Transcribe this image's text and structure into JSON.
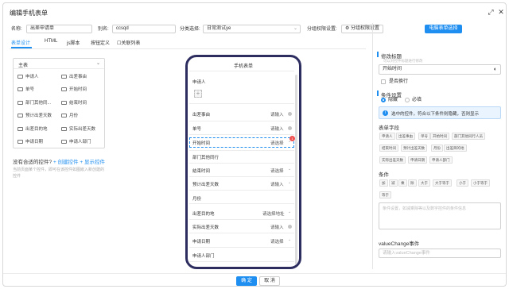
{
  "dialog": {
    "title": "编辑手机表单"
  },
  "header": {
    "name_label": "名称:",
    "name_value": "出差申请单",
    "alias_label": "别名:",
    "alias_value": "ccsqd",
    "category_label": "分类选择:",
    "category_value": "日常测试ye",
    "permission_label": "分组权限设置:",
    "permission_button": "分组权限设置",
    "pc_form_button": "电脑表单选择"
  },
  "tabs": [
    {
      "label": "表单设计",
      "active": true
    },
    {
      "label": "HTML"
    },
    {
      "label": "js脚本"
    },
    {
      "label": "按钮定义"
    },
    {
      "label": "关联列表"
    }
  ],
  "field_panel": {
    "header": "主表",
    "items": [
      "申请人",
      "出差事由",
      "单号",
      "开始时间",
      "部门其他同...",
      "结束时间",
      "预计出差天数",
      "月份",
      "出差目的地",
      "实际出差天数",
      "申请日期",
      "申请人部门"
    ]
  },
  "hint": {
    "question": "没有合适的控件?",
    "create_link": "+ 创建控件",
    "plus": "+",
    "show_link": "显示控件",
    "description": "当前页面某个控件，即可在该控件如图嵌入新创建的控件"
  },
  "phone_form": {
    "title": "手机表单",
    "fields": [
      {
        "label": "申请人",
        "placeholder": "",
        "type": "upload"
      },
      {
        "label": "出差事由",
        "placeholder": "请输入",
        "type": "input"
      },
      {
        "label": "单号",
        "placeholder": "请输入",
        "type": "input"
      },
      {
        "label": "开始时间",
        "placeholder": "请选择",
        "type": "select",
        "selected": true
      },
      {
        "label": "部门其他同行",
        "placeholder": "",
        "type": "text"
      },
      {
        "label": "结束时间",
        "placeholder": "请选择",
        "type": "select"
      },
      {
        "label": "预计出差天数",
        "placeholder": "请输入",
        "type": "input"
      },
      {
        "label": "月份",
        "placeholder": "",
        "type": "text"
      },
      {
        "label": "出差目的地",
        "placeholder": "请选择地址",
        "type": "select"
      },
      {
        "label": "实际出差天数",
        "placeholder": "请输入",
        "type": "input"
      },
      {
        "label": "申请日期",
        "placeholder": "请选择",
        "type": "select"
      },
      {
        "label": "申请人部门",
        "placeholder": "",
        "type": "text"
      }
    ],
    "badge": "1"
  },
  "right_panel": {
    "modify_title": "修改标题",
    "modify_subtitle": "可以对控件标题进行修改",
    "title_value": "开始时间",
    "wrap_label": "是否换行",
    "condition_title": "条件设置",
    "hide_label": "隐藏",
    "required_label": "必填",
    "info_text": "选中的控件，符合以下条件则隐藏，否则显示",
    "fields_title": "表单字段",
    "field_tags": [
      "申请人",
      "出差事由",
      "单号",
      "开始时间",
      "部门其他同行人员",
      "结束时间",
      "预计出差天数",
      "月份",
      "出差目的地",
      "实际出差天数",
      "申请日期",
      "申请人部门"
    ],
    "condition_label": "条件",
    "operator_tags": [
      "加",
      "减",
      "乘",
      "除",
      "大于",
      "大于等于",
      "小于",
      "小于等于",
      "等于"
    ],
    "condition_placeholder": "条件设置，如减乘除等以及数字控件的条件信息",
    "value_change_label": "valueChange事件",
    "value_change_placeholder": "请输入valueChange事件"
  },
  "footer": {
    "ok": "确 定",
    "cancel": "取 消"
  },
  "colors": {
    "primary": "#1f8ef1",
    "phone_border": "#2d2d60",
    "badge": "#f05050"
  }
}
